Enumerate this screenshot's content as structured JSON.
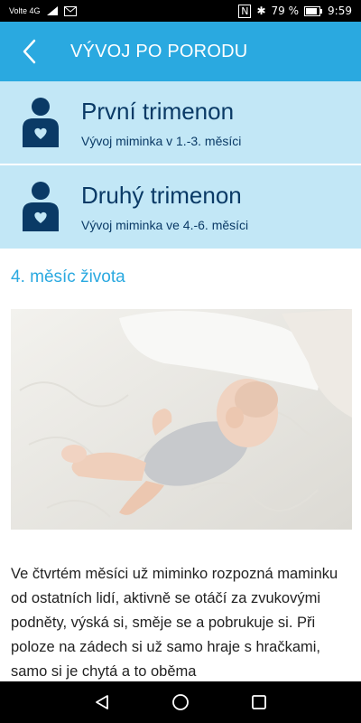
{
  "status_bar": {
    "carrier": "Volte 4G",
    "battery": "79 %",
    "time": "9:59"
  },
  "app_bar": {
    "title": "VÝVOJ PO PORODU",
    "back_icon": "chevron-left-icon"
  },
  "trimesters": [
    {
      "title": "První trimenon",
      "subtitle": "Vývoj miminka v 1.-3. měsíci",
      "icon": "mother-heart-icon"
    },
    {
      "title": "Druhý trimenon",
      "subtitle": "Vývoj miminka ve 4.-6. měsíci",
      "icon": "mother-heart-icon"
    }
  ],
  "section": {
    "heading": "4. měsíc života",
    "image": "baby-lying-on-blanket-photo",
    "text": "Ve čtvrtém měsíci už miminko rozpozná maminku od ostatních lidí, aktivně se otáčí za zvukovými podněty, výská si, směje se a pobrukuje si. Při poloze na zádech si už samo hraje s hračkami, samo si je chytá a to oběma"
  },
  "colors": {
    "primary": "#2aa9e0",
    "card_bg": "#c2e7f6",
    "dark_blue": "#0a3a66"
  }
}
